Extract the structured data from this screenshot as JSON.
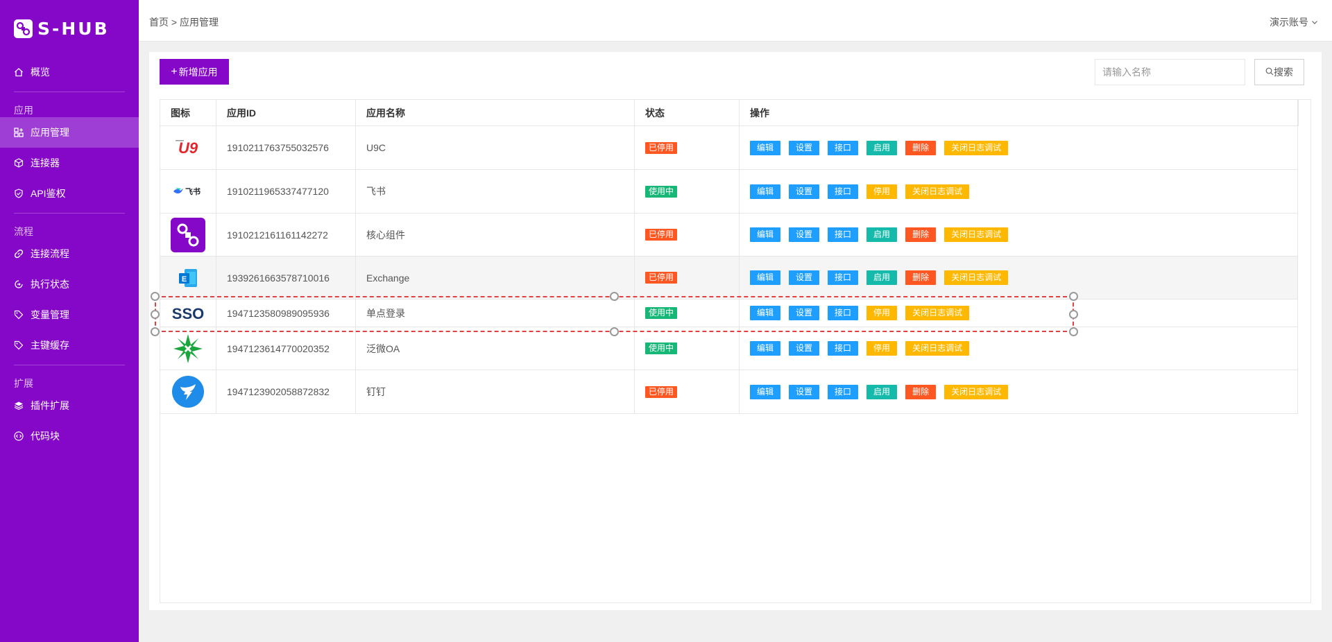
{
  "brand": {
    "name": "S-HUB"
  },
  "sidebar": {
    "top_items": [
      {
        "label": "概览",
        "icon": "home-icon"
      }
    ],
    "groups": [
      {
        "title": "应用",
        "items": [
          {
            "label": "应用管理",
            "icon": "app-grid-icon",
            "active": true
          },
          {
            "label": "连接器",
            "icon": "cube-icon"
          },
          {
            "label": "API鉴权",
            "icon": "shield-icon"
          }
        ]
      },
      {
        "title": "流程",
        "items": [
          {
            "label": "连接流程",
            "icon": "link-icon"
          },
          {
            "label": "执行状态",
            "icon": "status-icon"
          },
          {
            "label": "变量管理",
            "icon": "tag-icon"
          },
          {
            "label": "主键缓存",
            "icon": "tag-icon"
          }
        ]
      },
      {
        "title": "扩展",
        "items": [
          {
            "label": "插件扩展",
            "icon": "layers-icon"
          },
          {
            "label": "代码块",
            "icon": "code-icon"
          }
        ]
      }
    ]
  },
  "header": {
    "breadcrumb": "首页 > 应用管理",
    "account": "演示账号"
  },
  "toolbar": {
    "add_label": "新增应用",
    "search_placeholder": "请输入名称",
    "search_label": "搜索"
  },
  "table": {
    "headers": [
      "图标",
      "应用ID",
      "应用名称",
      "状态",
      "操作"
    ],
    "rows": [
      {
        "icon": "u9-logo",
        "id": "1910211763755032576",
        "name": "U9C",
        "status": "已停用",
        "actions": [
          "编辑",
          "设置",
          "接口",
          "启用",
          "删除",
          "关闭日志调试"
        ]
      },
      {
        "icon": "feishu-logo",
        "id": "1910211965337477120",
        "name": "飞书",
        "status": "使用中",
        "actions": [
          "编辑",
          "设置",
          "接口",
          "停用",
          "关闭日志调试"
        ]
      },
      {
        "icon": "core-component-logo",
        "id": "1910212161161142272",
        "name": "核心组件",
        "status": "已停用",
        "actions": [
          "编辑",
          "设置",
          "接口",
          "启用",
          "删除",
          "关闭日志调试"
        ]
      },
      {
        "icon": "exchange-logo",
        "id": "1939261663578710016",
        "name": "Exchange",
        "status": "已停用",
        "actions": [
          "编辑",
          "设置",
          "接口",
          "启用",
          "删除",
          "关闭日志调试"
        ]
      },
      {
        "icon": "sso-logo",
        "id": "1947123580989095936",
        "name": "单点登录",
        "status": "使用中",
        "actions": [
          "编辑",
          "设置",
          "接口",
          "停用",
          "关闭日志调试"
        ]
      },
      {
        "icon": "fanwei-oa-logo",
        "id": "1947123614770020352",
        "name": "泛微OA",
        "status": "使用中",
        "actions": [
          "编辑",
          "设置",
          "接口",
          "停用",
          "关闭日志调试"
        ]
      },
      {
        "icon": "dingtalk-logo",
        "id": "1947123902058872832",
        "name": "钉钉",
        "status": "已停用",
        "actions": [
          "编辑",
          "设置",
          "接口",
          "启用",
          "删除",
          "关闭日志调试"
        ]
      }
    ]
  },
  "colors": {
    "brand": "#8507c8",
    "active_nav": "#9e3ed4",
    "stopped": "#ff5722",
    "running": "#16b777",
    "primary": "#1e9fff",
    "enable": "#16baaa",
    "warn": "#ffb800"
  },
  "logo_texts": {
    "u9": "U9",
    "feishu": "飞书",
    "exchange": "E",
    "sso": "SSO"
  }
}
